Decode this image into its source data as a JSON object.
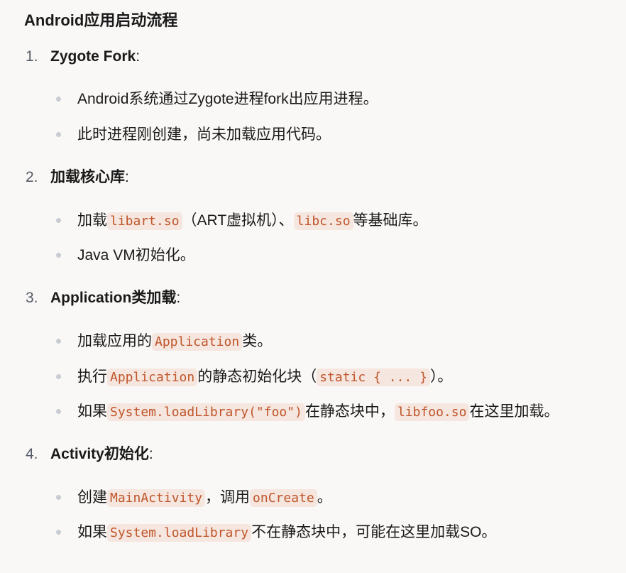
{
  "title": "Android应用启动流程",
  "sections": [
    {
      "num": "1.",
      "title": "Zygote Fork",
      "colon": ":",
      "bullets": [
        {
          "parts": [
            {
              "t": "Android系统通过Zygote进程fork出应用进程。"
            }
          ]
        },
        {
          "parts": [
            {
              "t": "此时进程刚创建，尚未加载应用代码。"
            }
          ]
        }
      ]
    },
    {
      "num": "2.",
      "title": "加载核心库",
      "colon": ":",
      "bullets": [
        {
          "parts": [
            {
              "t": "加载"
            },
            {
              "code": "libart.so"
            },
            {
              "t": "（ART虚拟机）、"
            },
            {
              "code": "libc.so"
            },
            {
              "t": "等基础库。"
            }
          ]
        },
        {
          "parts": [
            {
              "t": "Java VM初始化。"
            }
          ]
        }
      ]
    },
    {
      "num": "3.",
      "title": "Application类加载",
      "colon": ":",
      "bullets": [
        {
          "parts": [
            {
              "t": "加载应用的"
            },
            {
              "code": "Application"
            },
            {
              "t": "类。"
            }
          ]
        },
        {
          "parts": [
            {
              "t": "执行"
            },
            {
              "code": "Application"
            },
            {
              "t": "的静态初始化块（"
            },
            {
              "code": "static { ... }"
            },
            {
              "t": "）。"
            }
          ]
        },
        {
          "parts": [
            {
              "t": "如果"
            },
            {
              "code": "System.loadLibrary(\"foo\")"
            },
            {
              "t": "在静态块中，"
            },
            {
              "code": "libfoo.so"
            },
            {
              "t": "在这里加载。"
            }
          ]
        }
      ]
    },
    {
      "num": "4.",
      "title": "Activity初始化",
      "colon": ":",
      "bullets": [
        {
          "parts": [
            {
              "t": "创建"
            },
            {
              "code": "MainActivity"
            },
            {
              "t": "，调用"
            },
            {
              "code": "onCreate"
            },
            {
              "t": "。"
            }
          ]
        },
        {
          "parts": [
            {
              "t": "如果"
            },
            {
              "code": "System.loadLibrary"
            },
            {
              "t": "不在静态块中，可能在这里加载SO。"
            }
          ]
        }
      ]
    }
  ]
}
